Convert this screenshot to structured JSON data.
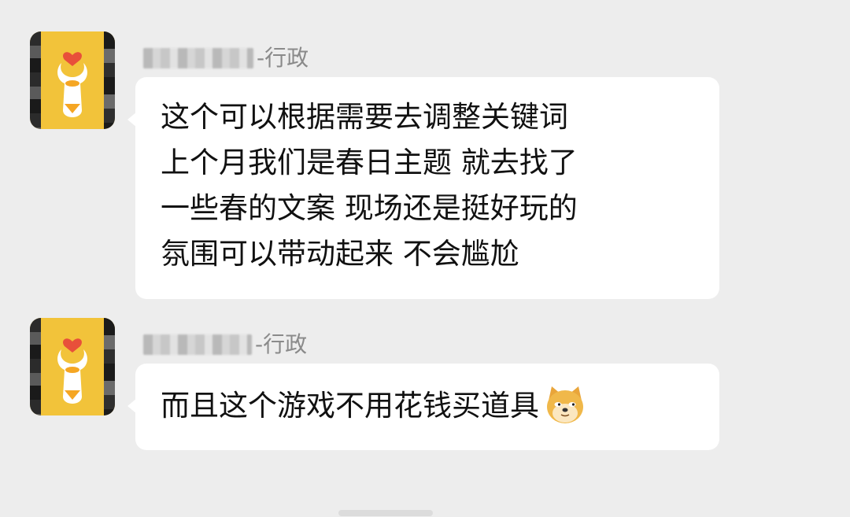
{
  "messages": [
    {
      "sender_suffix": "-行政",
      "lines": [
        "这个可以根据需要去调整关键词",
        "上个月我们是春日主题 就去找了",
        "一些春的文案 现场还是挺好玩的",
        "氛围可以带动起来 不会尴尬"
      ]
    },
    {
      "sender_suffix": "-行政",
      "text": "而且这个游戏不用花钱买道具",
      "emoji": "doge-icon"
    }
  ],
  "colors": {
    "background": "#ededed",
    "bubble": "#ffffff",
    "text": "#111111",
    "name": "#8a8a8a",
    "avatar_bg": "#f2c33a",
    "heart": "#e8503a"
  }
}
